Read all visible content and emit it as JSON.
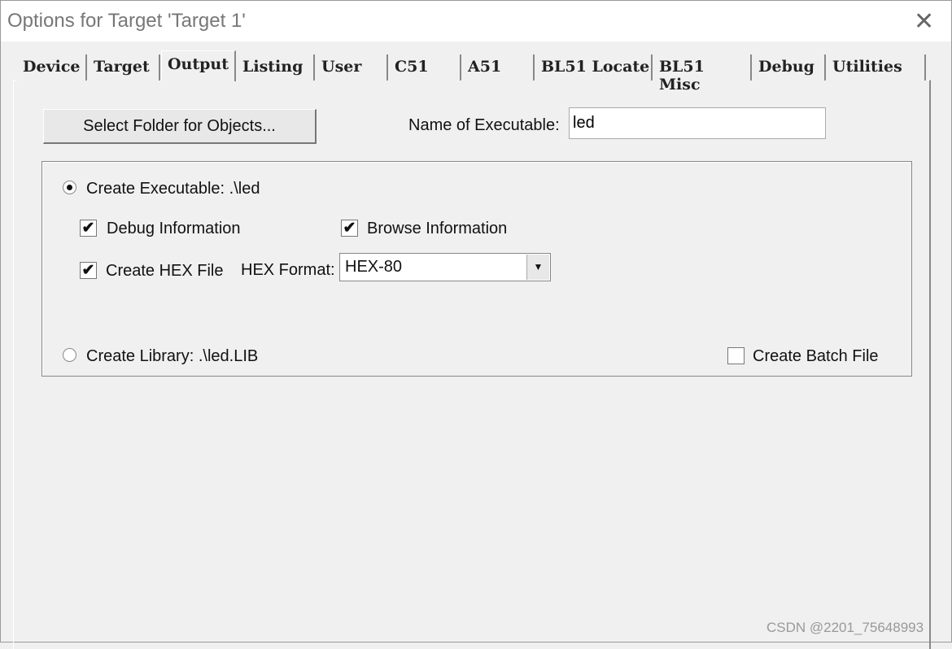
{
  "window": {
    "title": "Options for Target 'Target 1'",
    "close_icon": "close-icon"
  },
  "tabs": [
    {
      "label": "Device"
    },
    {
      "label": "Target"
    },
    {
      "label": "Output",
      "active": true
    },
    {
      "label": "Listing"
    },
    {
      "label": "User"
    },
    {
      "label": "C51"
    },
    {
      "label": "A51"
    },
    {
      "label": "BL51 Locate"
    },
    {
      "label": "BL51 Misc"
    },
    {
      "label": "Debug"
    },
    {
      "label": "Utilities"
    }
  ],
  "output": {
    "select_folder_label": "Select Folder for Objects...",
    "name_label": "Name of Executable:",
    "name_value": "led",
    "create_executable_label": "Create Executable:  .\\led",
    "create_executable_selected": true,
    "debug_info_label": "Debug Information",
    "debug_info_checked": true,
    "browse_info_label": "Browse Information",
    "browse_info_checked": true,
    "create_hex_label": "Create HEX File",
    "create_hex_checked": true,
    "hex_format_label": "HEX Format:",
    "hex_format_value": "HEX-80",
    "create_library_label": "Create Library:  .\\led.LIB",
    "create_library_selected": false,
    "batch_label": "Create Batch File",
    "batch_checked": false,
    "check_mark": "✔"
  },
  "watermark": "CSDN @2201_75648993"
}
